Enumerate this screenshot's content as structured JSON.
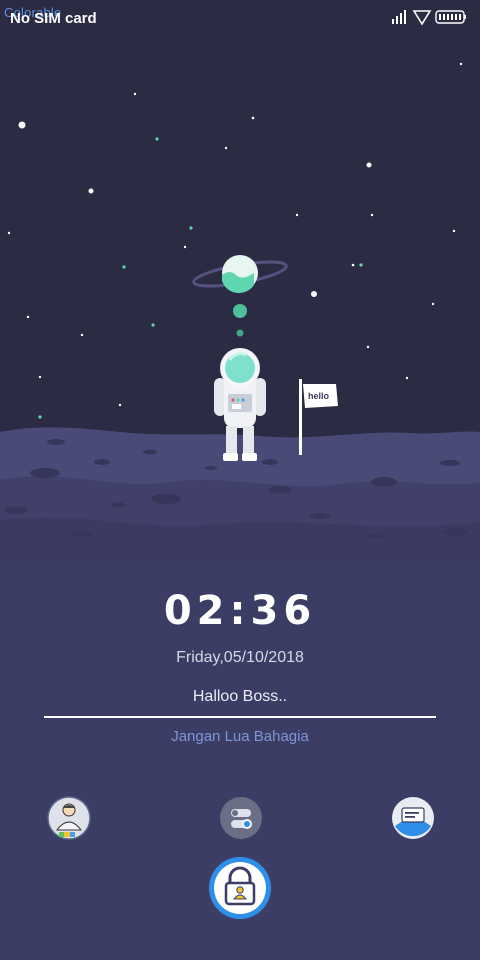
{
  "status_bar": {
    "brand": "Colorable",
    "carrier": "No SIM card",
    "icons": [
      "signal-icon",
      "wifi-icon",
      "battery-icon"
    ]
  },
  "flag_text": "hello",
  "lockscreen": {
    "time": "02:36",
    "date": "Friday,05/10/2018",
    "greeting": "Halloo Boss..",
    "motto": "Jangan Lua Bahagia"
  },
  "shortcuts": [
    {
      "name": "contacts",
      "icon": "contact-person-icon"
    },
    {
      "name": "settings",
      "icon": "toggle-settings-icon"
    },
    {
      "name": "messages",
      "icon": "message-envelope-icon"
    }
  ],
  "unlock": {
    "icon": "unlock-padlock-icon"
  },
  "colors": {
    "sky": "#2b2b44",
    "moon": "#49497a",
    "accent": "#2f8fe8",
    "planet": "#5fd5b0",
    "motto": "#7d95d6"
  }
}
